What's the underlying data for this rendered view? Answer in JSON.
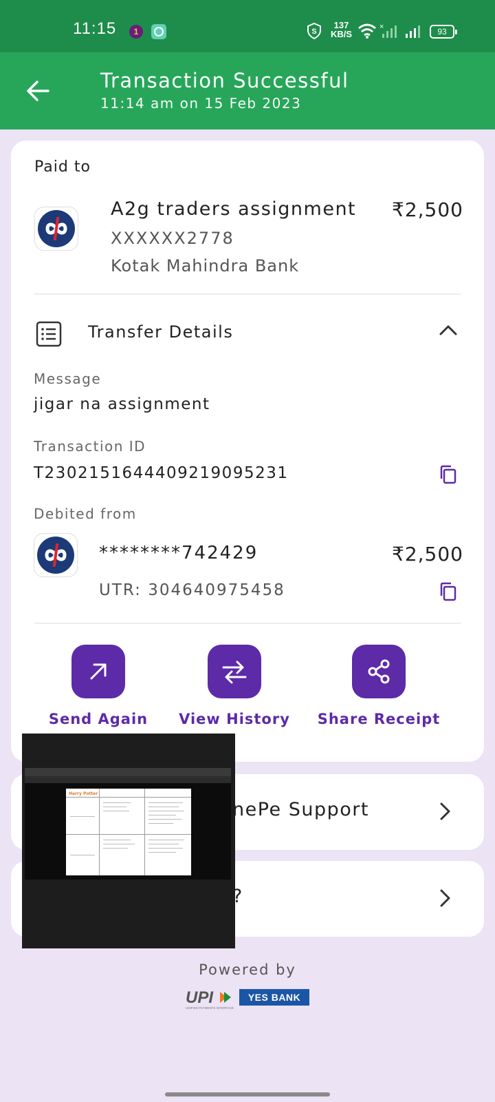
{
  "status_bar": {
    "time": "11:15",
    "notif_badge": "1",
    "net_speed_value": "137",
    "net_speed_unit": "KB/S",
    "battery": "93"
  },
  "header": {
    "title": "Transaction Successful",
    "subtitle": "11:14 am on 15 Feb 2023"
  },
  "paid_to": {
    "label": "Paid to",
    "name": "A2g traders assignment",
    "account": "XXXXXX2778",
    "bank": "Kotak Mahindra Bank",
    "amount": "₹2,500"
  },
  "transfer_details": {
    "label": "Transfer Details",
    "message_label": "Message",
    "message": "jigar na assignment",
    "txn_id_label": "Transaction ID",
    "txn_id": "T2302151644409219095231",
    "debited_label": "Debited from",
    "debited_account": "********742429",
    "debited_amount": "₹2,500",
    "utr": "UTR: 304640975458"
  },
  "actions": {
    "send_again": "Send Again",
    "view_history": "View History",
    "share_receipt": "Share Receipt"
  },
  "support_row": {
    "label": "nePe Support"
  },
  "faq_row": {
    "label": "?"
  },
  "pip_overlay": {
    "doc_title": "Harry Potter"
  },
  "footer": {
    "powered_by": "Powered by",
    "upi_caption": "UNIFIED PAYMENTS INTERFACE",
    "bank": "YES BANK"
  },
  "colors": {
    "status_bar": "#1e8c4a",
    "header": "#27a65a",
    "accent": "#5d2aa8",
    "background": "#ece3f5"
  }
}
